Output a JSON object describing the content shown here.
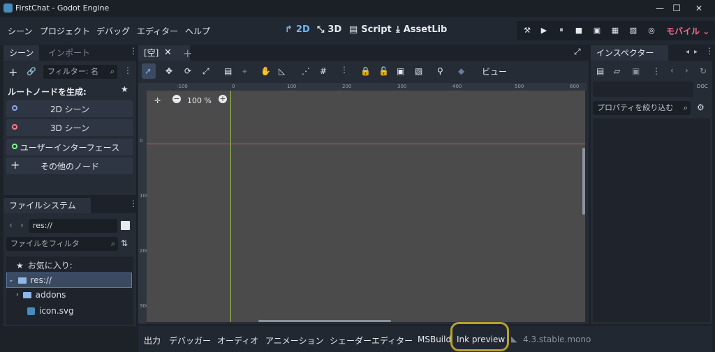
{
  "window": {
    "title": "FirstChat - Godot Engine",
    "minimize": "—",
    "maximize": "☐",
    "close": "✕"
  },
  "menubar": {
    "menus": [
      "シーン",
      "プロジェクト",
      "デバッグ",
      "エディター",
      "ヘルプ"
    ],
    "workspaces": [
      "2D",
      "3D",
      "Script",
      "AssetLib"
    ],
    "renderer": "モバイル"
  },
  "scene_dock": {
    "tabs": [
      "シーン",
      "インポート"
    ],
    "filter_placeholder": "フィルター: 名",
    "create_root_label": "ルートノードを生成:",
    "buttons": [
      "2D シーン",
      "3D シーン",
      "ユーザーインターフェース",
      "その他のノード"
    ],
    "ring_colors": [
      "#8da5f3",
      "#fc7f7f",
      "#8eef97"
    ]
  },
  "filesystem_dock": {
    "tab": "ファイルシステム",
    "path": "res://",
    "filter_placeholder": "ファイルをフィルタ",
    "favorites_label": "お気に入り:",
    "tree": [
      "res://",
      "addons",
      "icon.svg"
    ]
  },
  "editor": {
    "scene_tab": "[空]",
    "view_menu": "ビュー",
    "zoom": "100 %",
    "ruler_h": [
      "-100",
      "0",
      "100",
      "200",
      "300",
      "400",
      "500",
      "600"
    ],
    "ruler_v": [
      "0",
      "100",
      "200",
      "300"
    ]
  },
  "inspector": {
    "tab": "インスペクター",
    "filter_placeholder": "プロパティを絞り込む",
    "doc_label": "DOC"
  },
  "bottom_panel": {
    "tabs": [
      "出力",
      "デバッガー",
      "オーディオ",
      "アニメーション",
      "シェーダーエディター",
      "MSBuild",
      "Ink preview"
    ],
    "version": "4.3.stable.mono"
  }
}
